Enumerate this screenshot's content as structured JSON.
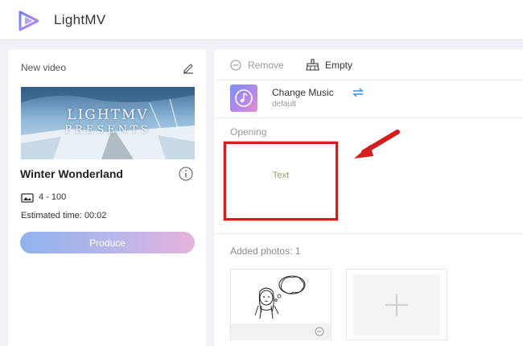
{
  "header": {
    "app_title": "LightMV",
    "logo_icon": "lightmv-logo-icon"
  },
  "sidebar": {
    "heading": "New video",
    "edit_icon": "pencil-icon",
    "thumbnail": {
      "line1": "LIGHTMV",
      "line2": "PRESENTS"
    },
    "video_name": "Winter Wonderland",
    "info_icon": "info-icon",
    "photo_range": "4 - 100",
    "estimated_time": "Estimated time: 00:02",
    "produce_label": "Produce"
  },
  "toolbar": {
    "remove_label": "Remove",
    "empty_label": "Empty"
  },
  "music": {
    "label": "Change Music",
    "sub": "default",
    "icon": "music-note-icon",
    "swap_icon": "swap-arrows-icon"
  },
  "opening": {
    "label": "Opening",
    "text_placeholder": "Text"
  },
  "photos": {
    "added_label": "Added photos: 1"
  },
  "colors": {
    "accent_red": "#d51d1d",
    "swap_blue": "#3a8ee6",
    "produce_gradient_start": "#8fb3ec",
    "produce_gradient_end": "#e7b3dc"
  }
}
